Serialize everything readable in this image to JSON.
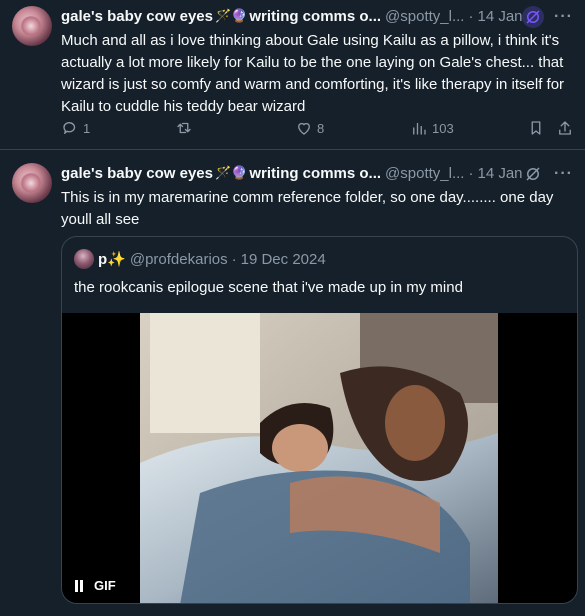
{
  "tweets": [
    {
      "display_name": "gale's baby cow eyes",
      "name_emojis": "🪄🔮",
      "name_suffix": "writing comms o...",
      "handle": "@spotty_l...",
      "dot": "·",
      "date": "14 Jan",
      "text": "Much and all as i love thinking about Gale using Kailu as a pillow, i think it's actually a lot more likely for Kailu to be the one laying on Gale's chest... that wizard is just so comfy and warm and comforting, it's like therapy in itself for Kailu to cuddle his teddy bear wizard",
      "stats": {
        "replies": "1",
        "retweets": "",
        "likes": "8",
        "views": "103"
      },
      "icons": {
        "grok": "grok-icon",
        "more": "more-icon",
        "reply": "reply-icon",
        "retweet": "retweet-icon",
        "like": "heart-icon",
        "views": "views-icon",
        "bookmark": "bookmark-icon",
        "share": "share-icon"
      }
    },
    {
      "display_name": "gale's baby cow eyes",
      "name_emojis": "🪄🔮",
      "name_suffix": "writing comms o...",
      "handle": "@spotty_l...",
      "dot": "·",
      "date": "14 Jan",
      "text": "This is in my maremarine comm reference folder, so one day........ one day youll all see",
      "quote": {
        "name": "p✨",
        "handle": "@profdekarios",
        "dot": "·",
        "date": "19 Dec 2024",
        "text": "the rookcanis epilogue scene that i've made up in my mind",
        "media_label": "GIF"
      }
    }
  ],
  "colors": {
    "background": "#15202b",
    "text": "#f7f9f9",
    "secondary": "#8b98a5",
    "border": "#38444d",
    "grok_accent": "#7856ff"
  }
}
